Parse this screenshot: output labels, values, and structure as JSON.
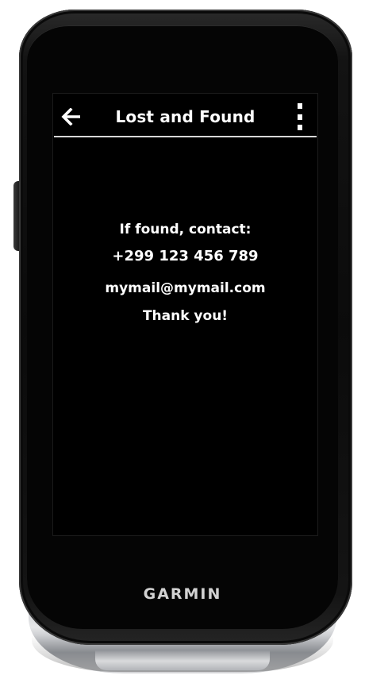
{
  "device": {
    "brand": "GARMIN"
  },
  "screen": {
    "header": {
      "title": "Lost and Found",
      "back_icon": "arrow-left-icon",
      "menu_icon": "vertical-ellipsis-icon"
    },
    "message": {
      "line1": "If found, contact:",
      "phone": "+299 123 456 789",
      "email": "mymail@mymail.com",
      "thanks": "Thank you!"
    }
  },
  "colors": {
    "screen_background": "#000000",
    "text": "#ffffff",
    "divider": "#d7d7d7",
    "device_body": "#0b0b0b",
    "bumper": "#c9cbce"
  }
}
